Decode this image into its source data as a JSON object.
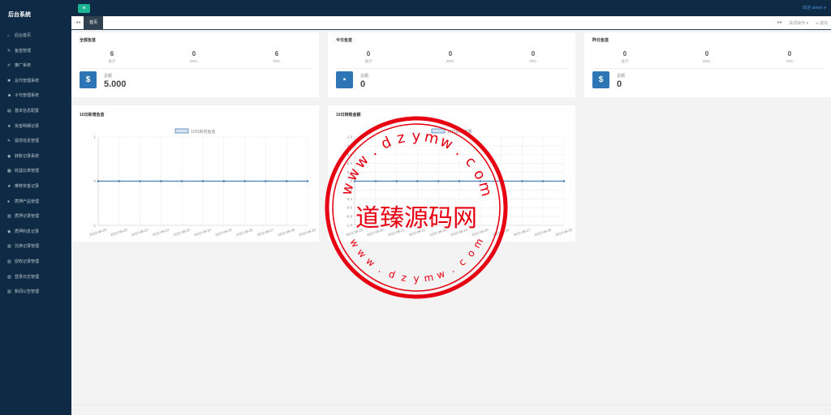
{
  "brand": "后台系统",
  "sidebar": {
    "items": [
      {
        "label": "后台首页",
        "icon": "home-icon",
        "glyph": "⌂"
      },
      {
        "label": "鱼苗管理",
        "icon": "wrench-icon",
        "glyph": "✎"
      },
      {
        "label": "推广系统",
        "icon": "edit-icon",
        "glyph": "✐"
      },
      {
        "label": "总代管理系统",
        "icon": "asterisk-icon",
        "glyph": "✱"
      },
      {
        "label": "子代管理系统",
        "icon": "users-icon",
        "glyph": "☻"
      },
      {
        "label": "基本信息配置",
        "icon": "file-icon",
        "glyph": "▤"
      },
      {
        "label": "资金明细记录",
        "icon": "star-icon",
        "glyph": "★"
      },
      {
        "label": "提现信息管理",
        "icon": "tag-icon",
        "glyph": "✎"
      },
      {
        "label": "转账记录系统",
        "icon": "power-icon",
        "glyph": "◉"
      },
      {
        "label": "收益比率管理",
        "icon": "table-icon",
        "glyph": "▦"
      },
      {
        "label": "推荐奖金记录",
        "icon": "star-icon",
        "glyph": "★"
      },
      {
        "label": "质押产品管理",
        "icon": "comment-icon",
        "glyph": "●"
      },
      {
        "label": "质押记录管理",
        "icon": "bank-icon",
        "glyph": "▥"
      },
      {
        "label": "质押利息记录",
        "icon": "power-icon",
        "glyph": "◉"
      },
      {
        "label": "兑换记录管理",
        "icon": "bank-icon",
        "glyph": "▥"
      },
      {
        "label": "授权记录管理",
        "icon": "bank-icon",
        "glyph": "▥"
      },
      {
        "label": "登录日志管理",
        "icon": "bank-icon",
        "glyph": "▥"
      },
      {
        "label": "新闻公告管理",
        "icon": "bank-icon",
        "glyph": "▥"
      }
    ]
  },
  "topbar": {
    "menu_glyph": "≡",
    "welcome": "欢迎 admin ▾"
  },
  "tabs": {
    "prev": "◂◂",
    "home": "首页",
    "next": "▸▸",
    "close_ops": "关闭操作 ▾",
    "logout": "⇲ 退出"
  },
  "cards": [
    {
      "title": "全部鱼苗",
      "stats": [
        {
          "value": "6",
          "label": "总计"
        },
        {
          "value": "0",
          "label": "ERC"
        },
        {
          "value": "6",
          "label": "TRC"
        }
      ],
      "total_label": "总额",
      "total_value": "5.000",
      "badge": "$"
    },
    {
      "title": "今日鱼苗",
      "stats": [
        {
          "value": "0",
          "label": "总计"
        },
        {
          "value": "0",
          "label": "ERC"
        },
        {
          "value": "0",
          "label": "TRC"
        }
      ],
      "total_label": "总额",
      "total_value": "0",
      "badge": "▪"
    },
    {
      "title": "昨日鱼苗",
      "stats": [
        {
          "value": "0",
          "label": "总计"
        },
        {
          "value": "0",
          "label": "ERC"
        },
        {
          "value": "0",
          "label": "TRC"
        }
      ],
      "total_label": "总额",
      "total_value": "0",
      "badge": "$"
    }
  ],
  "chart_data": [
    {
      "type": "line",
      "title": "10日新增鱼苗",
      "categories": [
        "2022-08-19",
        "2022-08-20",
        "2022-08-21",
        "2022-08-22",
        "2022-08-23",
        "2022-08-24",
        "2022-08-25",
        "2022-08-26",
        "2022-08-27",
        "2022-08-28",
        "2022-08-29"
      ],
      "series": [
        {
          "name": "10日新增鱼苗",
          "values": [
            0,
            0,
            0,
            0,
            0,
            0,
            0,
            0,
            0,
            0,
            0
          ]
        }
      ],
      "yticks": [
        "1",
        "0",
        "-1"
      ],
      "ylim": [
        -1,
        1
      ],
      "grid": true,
      "legend": "top-center",
      "color": "#4a7fb5"
    },
    {
      "type": "line",
      "title": "10日转账金额",
      "categories": [
        "2022-08-19",
        "2022-08-20",
        "2022-08-21",
        "2022-08-22",
        "2022-08-23",
        "2022-08-24",
        "2022-08-25",
        "2022-08-26",
        "2022-08-27",
        "2022-08-28",
        "2022-08-29"
      ],
      "series": [
        {
          "name": "10日转账金额",
          "values": [
            0,
            0,
            0,
            0,
            0,
            0,
            0,
            0,
            0,
            0,
            0
          ]
        }
      ],
      "yticks": [
        "1.0",
        "0.8",
        "0.6",
        "0.4",
        "0.2",
        "0",
        "-0.2",
        "-0.4",
        "-0.6",
        "-0.8",
        "-1.0"
      ],
      "ylim": [
        -1,
        1
      ],
      "grid": true,
      "legend": "top-center",
      "color": "#4a7fb5"
    }
  ],
  "watermark": {
    "top_text": "www.dzymw.com",
    "center_text": "道臻源码网",
    "bottom_text": "www.dzymw.com"
  },
  "colors": {
    "sidebar": "#0f2a44",
    "accent_green": "#1ab394",
    "badge_blue": "#2e75b6",
    "stamp_red": "#e60012"
  }
}
